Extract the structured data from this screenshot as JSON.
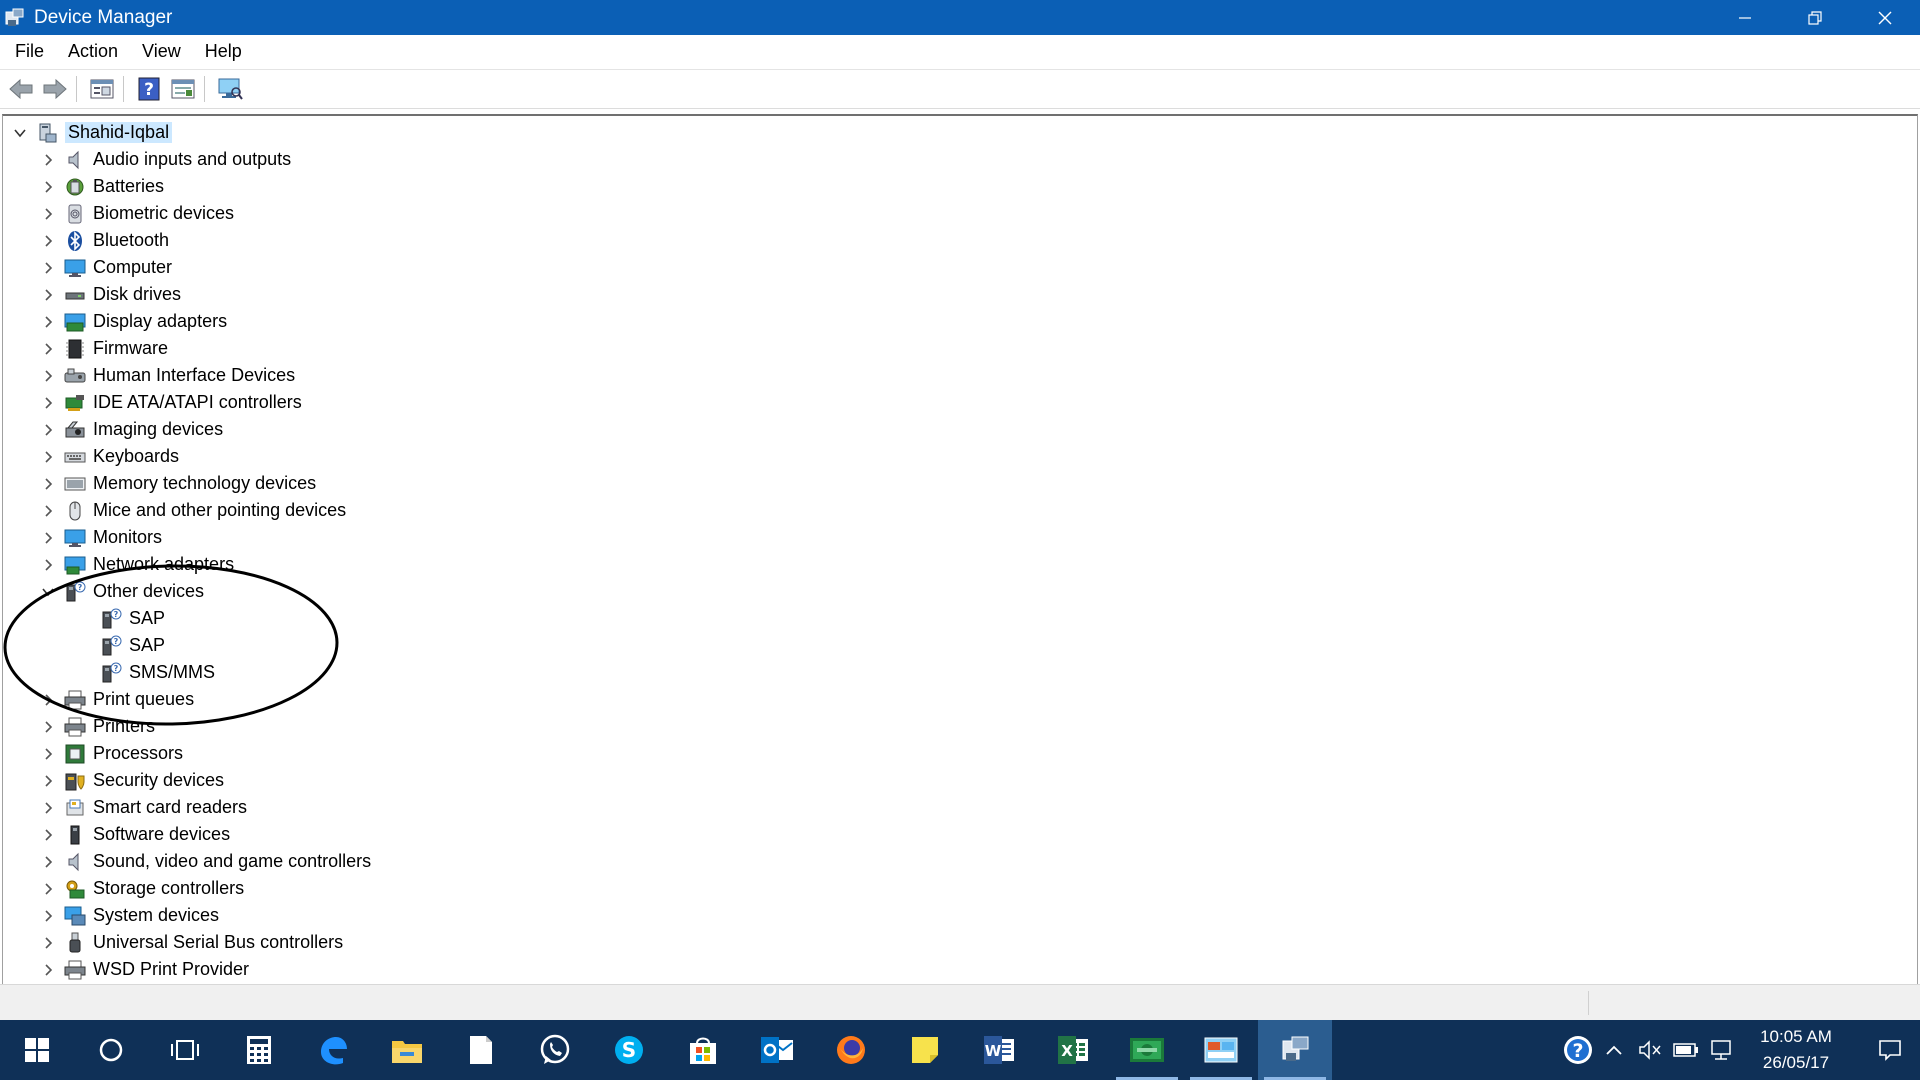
{
  "window": {
    "title": "Device Manager"
  },
  "menu": [
    {
      "label": "File"
    },
    {
      "label": "Action"
    },
    {
      "label": "View"
    },
    {
      "label": "Help"
    }
  ],
  "toolbar": [
    {
      "icon": "back-arrow-icon"
    },
    {
      "icon": "forward-arrow-icon"
    },
    {
      "icon": "properties-icon"
    },
    {
      "icon": "help-icon"
    },
    {
      "icon": "update-driver-icon"
    },
    {
      "icon": "scan-hardware-icon"
    }
  ],
  "tree": {
    "root": {
      "label": "Shahid-Iqbal",
      "icon": "computer-icon"
    },
    "categories": [
      {
        "label": "Audio inputs and outputs",
        "icon": "speaker-icon"
      },
      {
        "label": "Batteries",
        "icon": "battery-icon"
      },
      {
        "label": "Biometric devices",
        "icon": "fingerprint-icon"
      },
      {
        "label": "Bluetooth",
        "icon": "bluetooth-icon"
      },
      {
        "label": "Computer",
        "icon": "monitor-icon"
      },
      {
        "label": "Disk drives",
        "icon": "disk-drive-icon"
      },
      {
        "label": "Display adapters",
        "icon": "display-adapter-icon"
      },
      {
        "label": "Firmware",
        "icon": "chip-icon"
      },
      {
        "label": "Human Interface Devices",
        "icon": "hid-icon"
      },
      {
        "label": "IDE ATA/ATAPI controllers",
        "icon": "controller-card-icon"
      },
      {
        "label": "Imaging devices",
        "icon": "camera-icon"
      },
      {
        "label": "Keyboards",
        "icon": "keyboard-icon"
      },
      {
        "label": "Memory technology devices",
        "icon": "memory-icon"
      },
      {
        "label": "Mice and other pointing devices",
        "icon": "mouse-icon"
      },
      {
        "label": "Monitors",
        "icon": "monitor-icon"
      },
      {
        "label": "Network adapters",
        "icon": "network-adapter-icon"
      },
      {
        "label": "Other devices",
        "icon": "unknown-device-icon",
        "expanded": true,
        "children": [
          {
            "label": "SAP",
            "icon": "unknown-device-icon"
          },
          {
            "label": "SAP",
            "icon": "unknown-device-icon"
          },
          {
            "label": "SMS/MMS",
            "icon": "unknown-device-icon"
          }
        ]
      },
      {
        "label": "Print queues",
        "icon": "printer-icon"
      },
      {
        "label": "Printers",
        "icon": "printer-icon"
      },
      {
        "label": "Processors",
        "icon": "processor-icon"
      },
      {
        "label": "Security devices",
        "icon": "security-device-icon"
      },
      {
        "label": "Smart card readers",
        "icon": "smart-card-icon"
      },
      {
        "label": "Software devices",
        "icon": "software-device-icon"
      },
      {
        "label": "Sound, video and game controllers",
        "icon": "speaker-icon"
      },
      {
        "label": "Storage controllers",
        "icon": "storage-controller-icon"
      },
      {
        "label": "System devices",
        "icon": "system-devices-icon"
      },
      {
        "label": "Universal Serial Bus controllers",
        "icon": "usb-icon"
      },
      {
        "label": "WSD Print Provider",
        "icon": "printer-icon"
      }
    ]
  },
  "taskbar": {
    "apps": [
      {
        "icon": "windows-start-icon"
      },
      {
        "icon": "cortana-search-icon"
      },
      {
        "icon": "task-view-icon"
      },
      {
        "icon": "calculator-icon"
      },
      {
        "icon": "edge-browser-icon"
      },
      {
        "icon": "file-explorer-icon"
      },
      {
        "icon": "notepad-icon"
      },
      {
        "icon": "whatsapp-icon"
      },
      {
        "icon": "skype-icon"
      },
      {
        "icon": "store-icon"
      },
      {
        "icon": "outlook-icon"
      },
      {
        "icon": "firefox-icon"
      },
      {
        "icon": "sticky-notes-icon"
      },
      {
        "icon": "word-icon"
      },
      {
        "icon": "excel-icon"
      },
      {
        "icon": "money-app-icon"
      },
      {
        "icon": "control-panel-icon"
      },
      {
        "icon": "device-manager-icon"
      }
    ],
    "clock": {
      "time": "10:05 AM",
      "date": "26/05/17"
    }
  },
  "colors": {
    "titlebar": "#0b5fb5",
    "taskbar": "#0f3057",
    "selection": "#cce8ff"
  }
}
